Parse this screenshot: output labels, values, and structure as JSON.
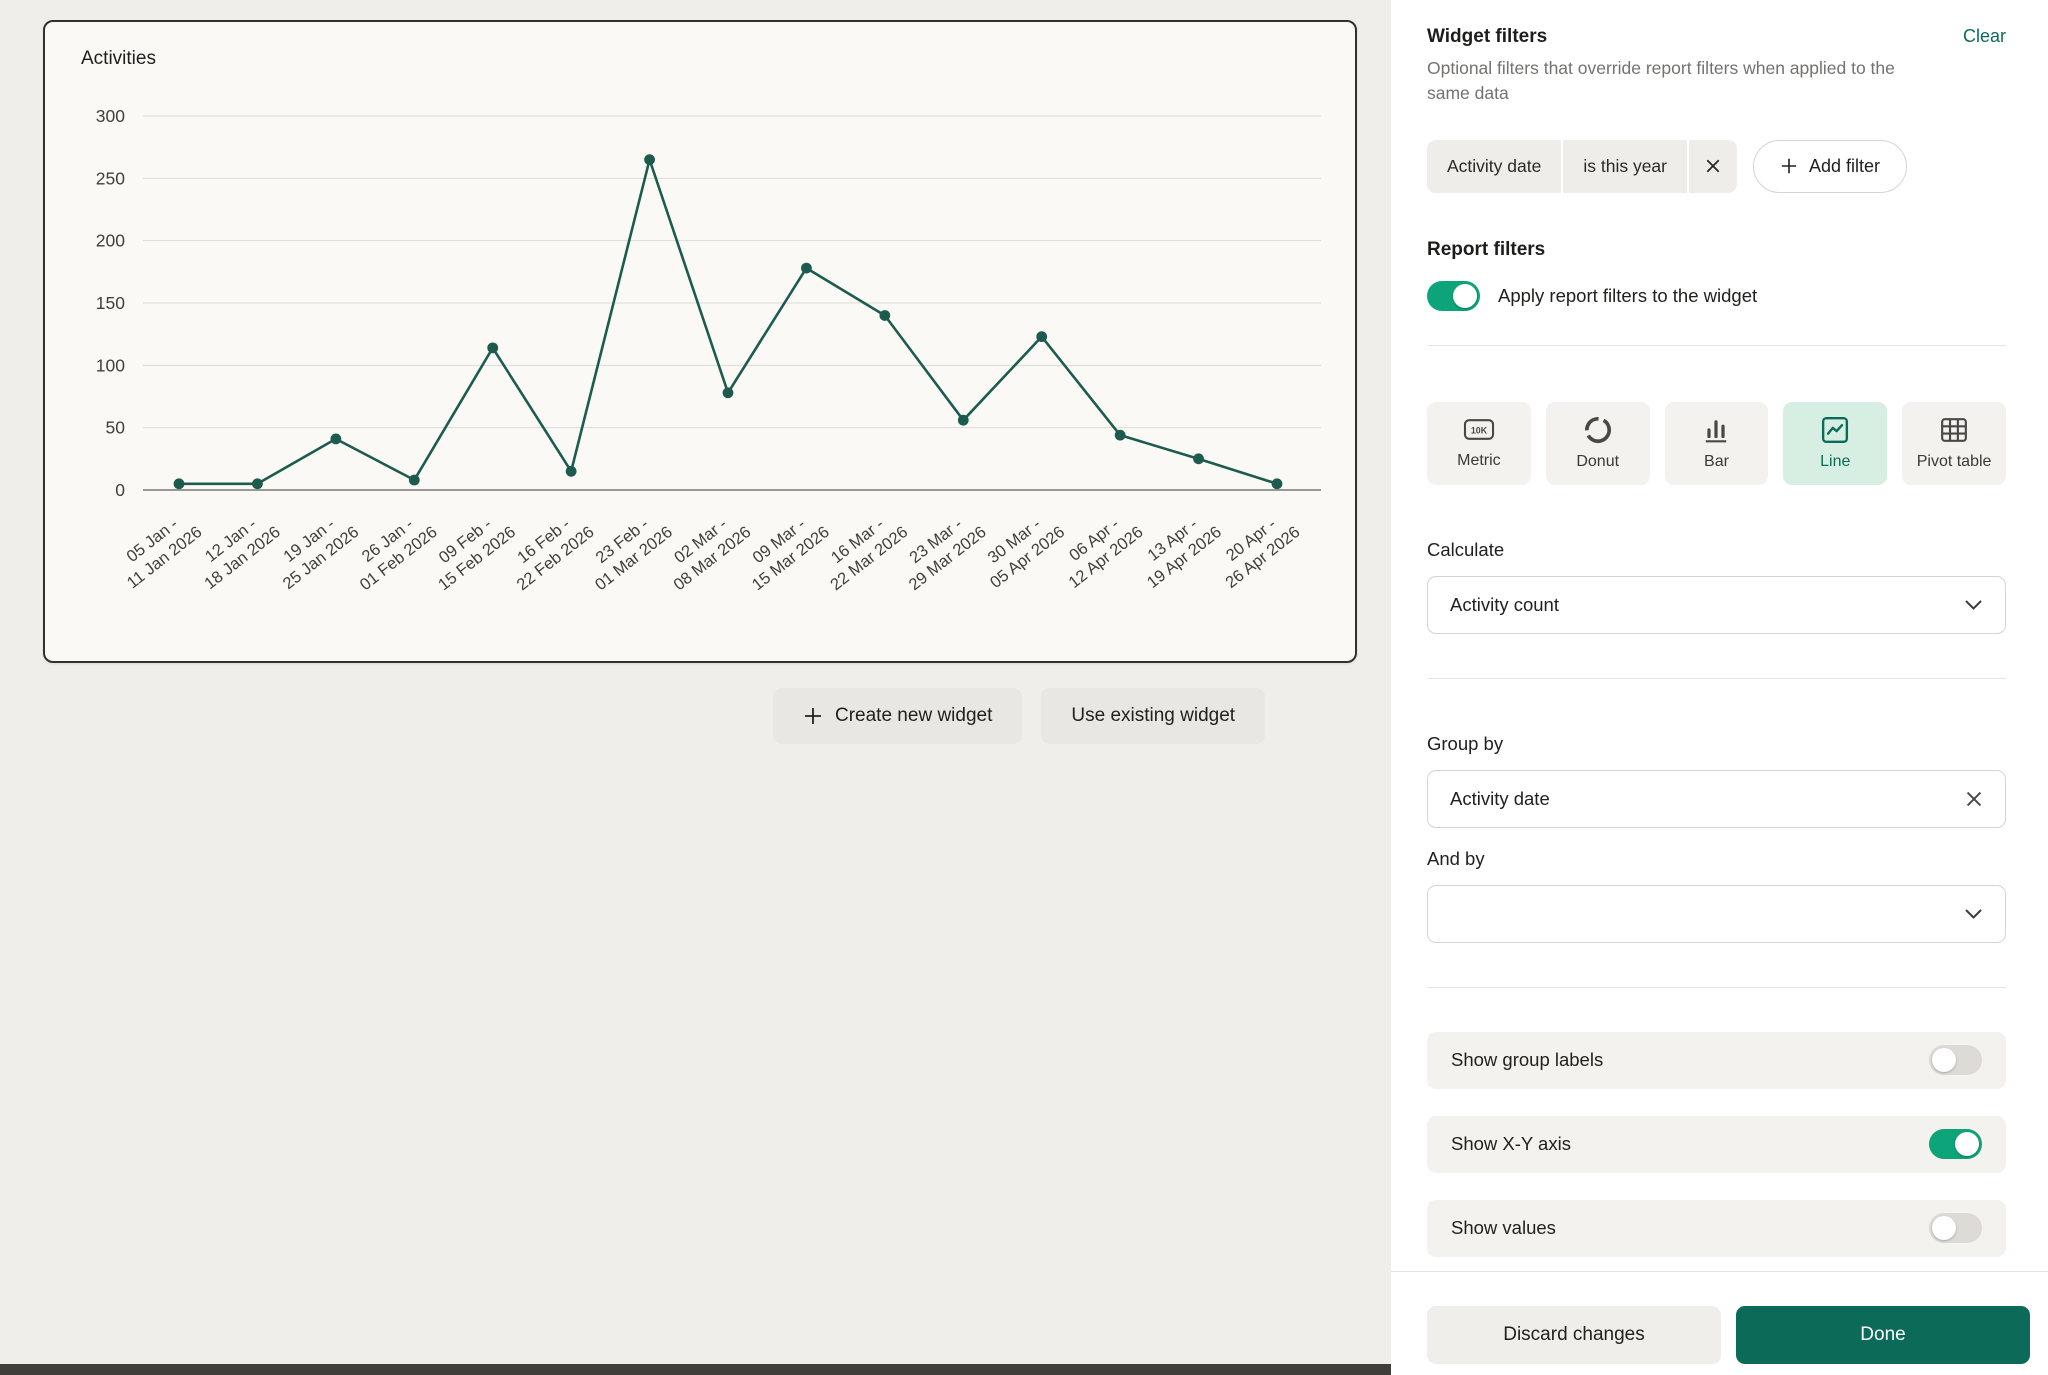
{
  "widget": {
    "title": "Activities"
  },
  "chart_data": {
    "type": "line",
    "title": "Activities",
    "categories": [
      [
        "05 Jan -",
        "11 Jan 2026"
      ],
      [
        "12 Jan -",
        "18 Jan 2026"
      ],
      [
        "19 Jan -",
        "25 Jan 2026"
      ],
      [
        "26 Jan -",
        "01 Feb 2026"
      ],
      [
        "09 Feb -",
        "15 Feb 2026"
      ],
      [
        "16 Feb -",
        "22 Feb 2026"
      ],
      [
        "23 Feb -",
        "01 Mar 2026"
      ],
      [
        "02 Mar -",
        "08 Mar 2026"
      ],
      [
        "09 Mar -",
        "15 Mar 2026"
      ],
      [
        "16 Mar -",
        "22 Mar 2026"
      ],
      [
        "23 Mar -",
        "29 Mar 2026"
      ],
      [
        "30 Mar -",
        "05 Apr 2026"
      ],
      [
        "06 Apr -",
        "12 Apr 2026"
      ],
      [
        "13 Apr -",
        "19 Apr 2026"
      ],
      [
        "20 Apr -",
        "26 Apr 2026"
      ]
    ],
    "values": [
      5,
      5,
      41,
      8,
      114,
      15,
      265,
      78,
      178,
      140,
      56,
      123,
      44,
      25,
      5
    ],
    "ylim": [
      0,
      300
    ],
    "yticks": [
      0,
      50,
      100,
      150,
      200,
      250,
      300
    ],
    "grid": true,
    "legend": false,
    "line_color": "#1d5b4f",
    "xlabel": "",
    "ylabel": ""
  },
  "canvas": {
    "create_new_label": "Create new widget",
    "use_existing_label": "Use existing widget"
  },
  "panel": {
    "widget_filters": {
      "title": "Widget filters",
      "clear_label": "Clear",
      "description": "Optional filters that override report filters when applied to the same data",
      "chip": {
        "field": "Activity date",
        "condition": "is this year"
      },
      "add_filter_label": "Add filter"
    },
    "report_filters": {
      "title": "Report filters",
      "toggle_label": "Apply report filters to the widget",
      "enabled": true
    },
    "chart_types": [
      {
        "label": "Metric",
        "selected": false
      },
      {
        "label": "Donut",
        "selected": false
      },
      {
        "label": "Bar",
        "selected": false
      },
      {
        "label": "Line",
        "selected": true
      },
      {
        "label": "Pivot table",
        "selected": false
      }
    ],
    "calculate": {
      "label": "Calculate",
      "value": "Activity count"
    },
    "group_by": {
      "label": "Group by",
      "value": "Activity date"
    },
    "and_by": {
      "label": "And by",
      "value": ""
    },
    "options": [
      {
        "label": "Show group labels",
        "on": false
      },
      {
        "label": "Show X-Y axis",
        "on": true
      },
      {
        "label": "Show values",
        "on": false
      }
    ],
    "footer": {
      "discard_label": "Discard changes",
      "done_label": "Done"
    }
  },
  "colors": {
    "accent": "#0c6b58",
    "toggle_on": "#0ea47a",
    "chart_line": "#1d5b4f",
    "selected_card_bg": "#d7efe3"
  }
}
